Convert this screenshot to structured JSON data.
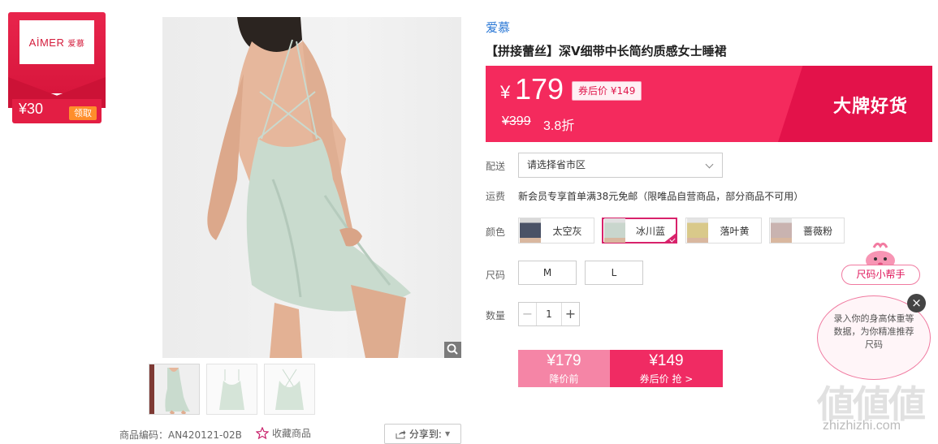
{
  "coupon": {
    "logo_text": "AİMER",
    "logo_cn": "爱慕",
    "amount": "¥30",
    "claim_label": "领取"
  },
  "gallery": {
    "thumbnails": [
      "model-back",
      "dress-front",
      "dress-back"
    ],
    "sku_line": "商品编码：AN420121-02B",
    "favorite_label": "收藏商品",
    "share_label": "分享到:"
  },
  "product": {
    "brand": "爱慕",
    "title": "【拼接蕾丝】深V细带中长简约质感女士睡裙",
    "price_currency": "¥",
    "price": "179",
    "coupon_price": "券后价 ¥149",
    "original_price": "¥399",
    "discount": "3.8折",
    "slogan": "大牌好货",
    "colors": {
      "band": "#f42a5d",
      "accent": "#d8226b",
      "brand_link": "#2c79d6"
    }
  },
  "options": {
    "delivery_label": "配送",
    "delivery_placeholder": "请选择省市区",
    "shipping_label": "运费",
    "shipping_text": "新会员专享首单满38元免邮（限唯品自营商品，部分商品不可用）",
    "color_label": "颜色",
    "color_choices": [
      {
        "name": "太空灰",
        "swatch": "#4a5266"
      },
      {
        "name": "冰川蓝",
        "swatch": "#c9d6cd"
      },
      {
        "name": "落叶黄",
        "swatch": "#d9c98a"
      },
      {
        "name": "蔷薇粉",
        "swatch": "#c9b3b0"
      }
    ],
    "selected_color": "冰川蓝",
    "size_label": "尺码",
    "sizes": [
      "M",
      "L"
    ],
    "qty_label": "数量",
    "qty_minus": "−",
    "qty_value": "1",
    "qty_plus": "+"
  },
  "buy": {
    "before_price": "¥179",
    "before_label": "降价前",
    "after_price": "¥149",
    "after_label": "券后价 抢 >"
  },
  "helper": {
    "tag": "尺码小帮手",
    "bubble_text": "录入你的身高体重等数据，为你精准推荐尺码",
    "close": "×"
  },
  "watermark": {
    "glyphs": "値値値",
    "url": "zhizhizhi.com"
  }
}
